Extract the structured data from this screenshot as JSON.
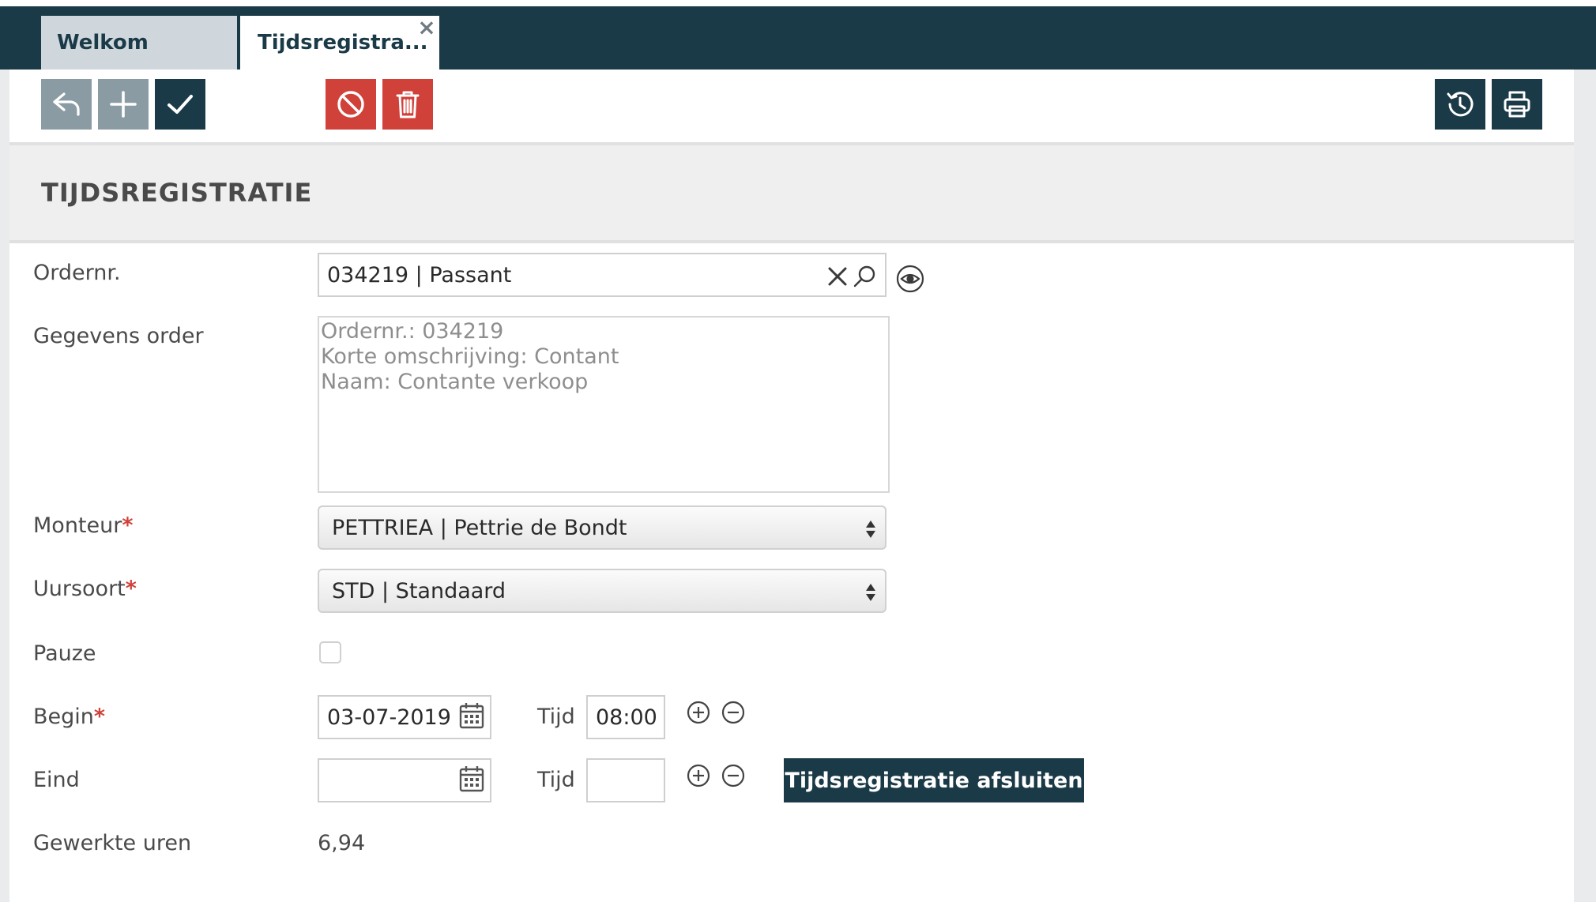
{
  "tabs": [
    {
      "label": "Welkom"
    },
    {
      "label": "Tijdsregistra..."
    }
  ],
  "toolbar": {
    "left_buttons": [
      "undo-icon",
      "plus-icon",
      "check-icon"
    ],
    "danger_buttons": [
      "cancel-icon",
      "trash-icon"
    ],
    "right_buttons": [
      "history-icon",
      "print-icon"
    ]
  },
  "section": {
    "title": "TIJDSREGISTRATIE"
  },
  "form": {
    "ordernr": {
      "label": "Ordernr.",
      "value": "034219 | Passant"
    },
    "gegevens": {
      "label": "Gegevens order",
      "lines": [
        "Ordernr.: 034219",
        "Korte omschrijving: Contant",
        "Naam: Contante verkoop"
      ]
    },
    "monteur": {
      "label": "Monteur",
      "required_mark": "*",
      "value": "PETTRIEA | Pettrie de Bondt"
    },
    "uursoort": {
      "label": "Uursoort",
      "required_mark": "*",
      "value": "STD | Standaard"
    },
    "pauze": {
      "label": "Pauze",
      "checked": false
    },
    "begin": {
      "label": "Begin",
      "required_mark": "*",
      "date": "03-07-2019",
      "time_label": "Tijd",
      "time": "08:00"
    },
    "eind": {
      "label": "Eind",
      "date": "",
      "time_label": "Tijd",
      "time": ""
    },
    "close_button": "Tijdsregistratie afsluiten",
    "gewerkte_uren": {
      "label": "Gewerkte uren",
      "value": "6,94"
    }
  },
  "colors": {
    "primary": "#1b3a47",
    "danger": "#d0413a",
    "grey_button": "#8b9ba4"
  }
}
